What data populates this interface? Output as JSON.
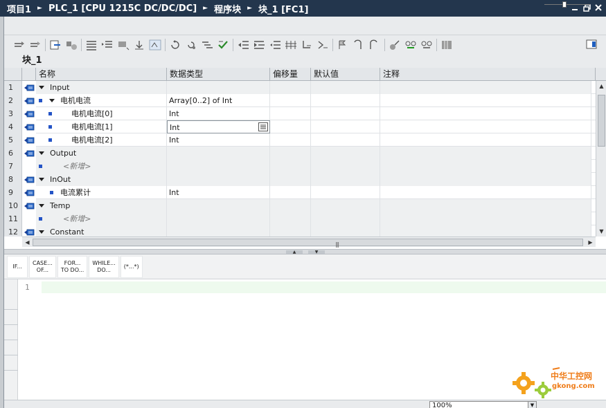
{
  "breadcrumb": {
    "items": [
      "项目1",
      "PLC_1 [CPU 1215C DC/DC/DC]",
      "程序块",
      "块_1 [FC1]"
    ],
    "separator": "►"
  },
  "window_controls": [
    "minimize-icon",
    "restore-icon",
    "close-icon"
  ],
  "block": {
    "title": "块_1"
  },
  "table": {
    "columns": [
      "名称",
      "数据类型",
      "偏移量",
      "默认值",
      "注释"
    ],
    "rows": [
      {
        "num": "1",
        "name": "Input",
        "type": "",
        "kind": "section",
        "level": 0
      },
      {
        "num": "2",
        "name": "电机电流",
        "type": "Array[0..2] of Int",
        "kind": "var-expand",
        "level": 1
      },
      {
        "num": "3",
        "name": "电机电流[0]",
        "type": "Int",
        "kind": "element",
        "level": 2
      },
      {
        "num": "4",
        "name": "电机电流[1]",
        "type": "Int",
        "kind": "element",
        "level": 2,
        "selected": true
      },
      {
        "num": "5",
        "name": "电机电流[2]",
        "type": "Int",
        "kind": "element",
        "level": 2
      },
      {
        "num": "6",
        "name": "Output",
        "type": "",
        "kind": "section",
        "level": 0
      },
      {
        "num": "7",
        "name": "<新增>",
        "type": "",
        "kind": "add",
        "level": 1
      },
      {
        "num": "8",
        "name": "InOut",
        "type": "",
        "kind": "section",
        "level": 0
      },
      {
        "num": "9",
        "name": "电流累计",
        "type": "Int",
        "kind": "var",
        "level": 1
      },
      {
        "num": "10",
        "name": "Temp",
        "type": "",
        "kind": "section",
        "level": 0
      },
      {
        "num": "11",
        "name": "<新增>",
        "type": "",
        "kind": "add",
        "level": 1
      },
      {
        "num": "12",
        "name": "Constant",
        "type": "",
        "kind": "section",
        "level": 0
      }
    ]
  },
  "snippets": [
    {
      "line1": "IF...",
      "line2": ""
    },
    {
      "line1": "CASE...",
      "line2": "OF..."
    },
    {
      "line1": "FOR...",
      "line2": "TO DO..."
    },
    {
      "line1": "WHILE...",
      "line2": "DO..."
    },
    {
      "line1": "(*...*)",
      "line2": ""
    }
  ],
  "editor": {
    "line_number": "1"
  },
  "status": {
    "zoom": "100%"
  },
  "watermark": {
    "text": "中华工控网",
    "sub": "gkong.com"
  },
  "colors": {
    "titlebar": "#23364d",
    "accent_blue": "#2454c6",
    "watermark": "#ef7d1a"
  }
}
